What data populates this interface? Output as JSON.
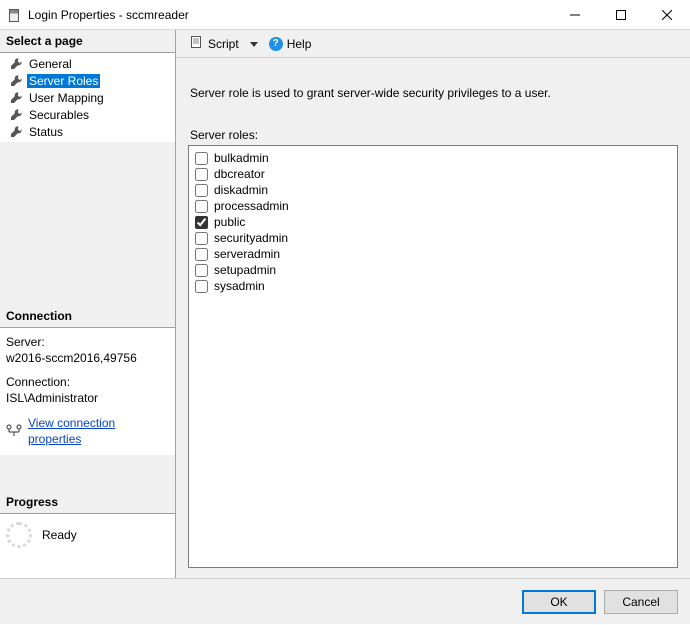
{
  "window": {
    "title": "Login Properties - sccmreader"
  },
  "sidebar": {
    "select_page_header": "Select a page",
    "pages": [
      {
        "label": "General",
        "selected": false
      },
      {
        "label": "Server Roles",
        "selected": true
      },
      {
        "label": "User Mapping",
        "selected": false
      },
      {
        "label": "Securables",
        "selected": false
      },
      {
        "label": "Status",
        "selected": false
      }
    ],
    "connection_header": "Connection",
    "server_label": "Server:",
    "server_value": "w2016-sccm2016,49756",
    "connection_label": "Connection:",
    "connection_value": "ISL\\Administrator",
    "view_connection_link": "View connection properties",
    "progress_header": "Progress",
    "progress_status": "Ready"
  },
  "toolbar": {
    "script_label": "Script",
    "help_label": "Help"
  },
  "main": {
    "description": "Server role is used to grant server-wide security privileges to a user.",
    "roles_label": "Server roles:",
    "roles": [
      {
        "name": "bulkadmin",
        "checked": false
      },
      {
        "name": "dbcreator",
        "checked": false
      },
      {
        "name": "diskadmin",
        "checked": false
      },
      {
        "name": "processadmin",
        "checked": false
      },
      {
        "name": "public",
        "checked": true
      },
      {
        "name": "securityadmin",
        "checked": false
      },
      {
        "name": "serveradmin",
        "checked": false
      },
      {
        "name": "setupadmin",
        "checked": false
      },
      {
        "name": "sysadmin",
        "checked": false
      }
    ]
  },
  "footer": {
    "ok_label": "OK",
    "cancel_label": "Cancel"
  }
}
